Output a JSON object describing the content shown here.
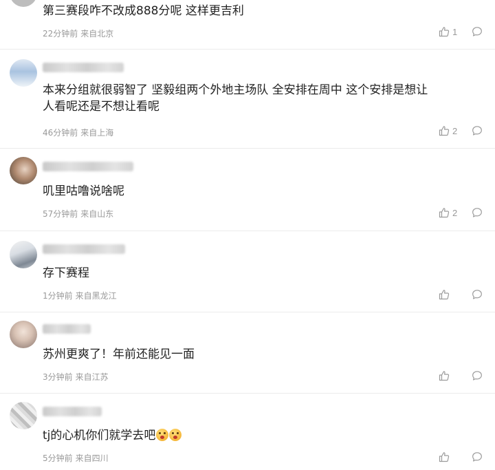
{
  "comments": [
    {
      "text": "第三赛段咋不改成888分呢 这样更吉利",
      "time": "22分钟前",
      "location": "来自北京",
      "likes": "1"
    },
    {
      "text": "本来分组就很弱智了 坚毅组两个外地主场队 全安排在周中 这个安排是想让人看呢还是不想让看呢",
      "time": "46分钟前",
      "location": "来自上海",
      "likes": "2"
    },
    {
      "text": "叽里咕噜说啥呢",
      "time": "57分钟前",
      "location": "来自山东",
      "likes": "2"
    },
    {
      "text": "存下赛程",
      "time": "1分钟前",
      "location": "来自黑龙江",
      "likes": ""
    },
    {
      "text": "苏州更爽了！年前还能见一面",
      "time": "3分钟前",
      "location": "来自江苏",
      "likes": ""
    },
    {
      "text": "tj的心机你们就学去吧",
      "time": "5分钟前",
      "location": "来自四川",
      "likes": ""
    }
  ],
  "icons": {
    "like": "thumbs-up-icon",
    "reply": "comment-bubble-icon"
  }
}
